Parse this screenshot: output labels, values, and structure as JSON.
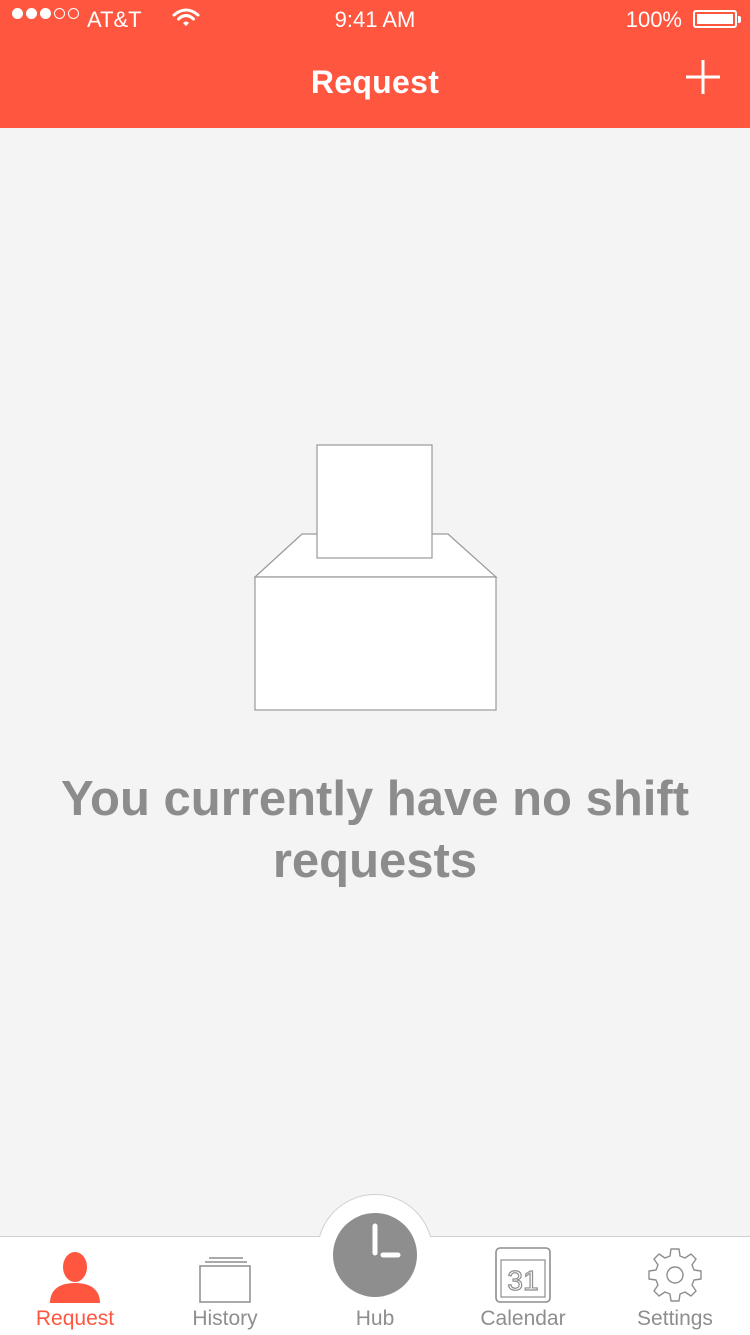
{
  "status_bar": {
    "carrier": "AT&T",
    "time": "9:41 AM",
    "battery": "100%",
    "signal_bars_filled": 3,
    "signal_bars_total": 5
  },
  "header": {
    "title": "Request",
    "add_icon": "plus-icon"
  },
  "empty_state": {
    "icon": "ballot-box-icon",
    "message": "You currently have no shift requests"
  },
  "tabs": [
    {
      "label": "Request",
      "icon": "person-icon",
      "active": true
    },
    {
      "label": "History",
      "icon": "history-stack-icon",
      "active": false
    },
    {
      "label": "Hub",
      "icon": "clock-icon",
      "active": false
    },
    {
      "label": "Calendar",
      "icon": "calendar-icon",
      "active": false
    },
    {
      "label": "Settings",
      "icon": "gear-icon",
      "active": false
    }
  ],
  "colors": {
    "accent": "#ff563f",
    "background": "#f4f4f4",
    "muted_text": "#8c8c8c",
    "inactive_icon": "#8e8e8e"
  },
  "calendar_icon_day": "31"
}
